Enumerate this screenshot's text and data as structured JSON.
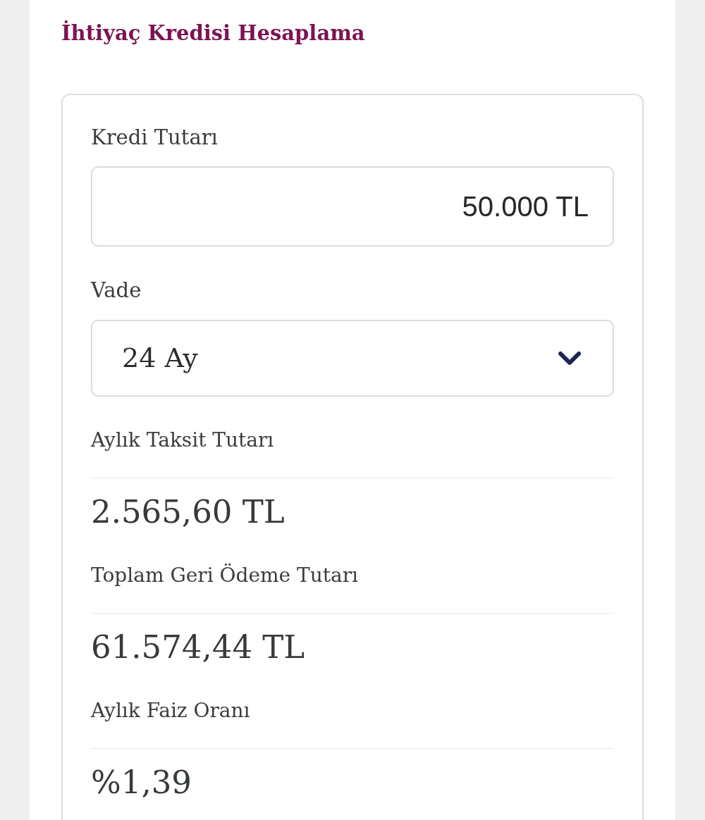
{
  "page": {
    "title": "İhtiyaç Kredisi Hesaplama"
  },
  "amount": {
    "label": "Kredi Tutarı",
    "value": "50.000 TL"
  },
  "term": {
    "label": "Vade",
    "value": "24 Ay"
  },
  "results": [
    {
      "label": "Aylık Taksit Tutarı",
      "value": "2.565,60 TL"
    },
    {
      "label": "Toplam Geri Ödeme Tutarı",
      "value": "61.574,44 TL"
    },
    {
      "label": "Aylık Faiz Oranı",
      "value": "%1,39"
    }
  ]
}
